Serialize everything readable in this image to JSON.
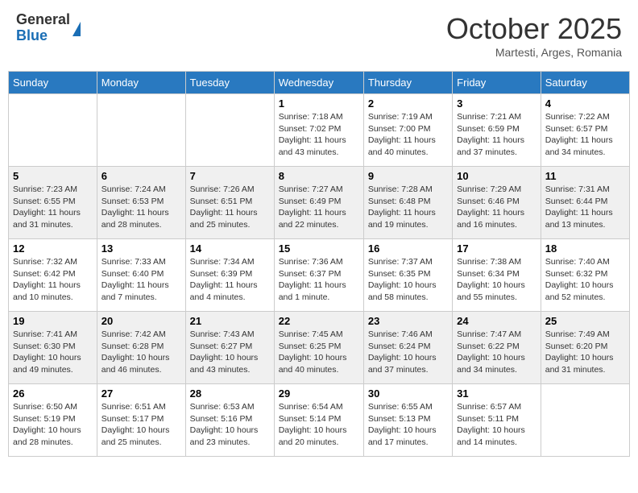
{
  "header": {
    "logo_general": "General",
    "logo_blue": "Blue",
    "month": "October 2025",
    "location": "Martesti, Arges, Romania"
  },
  "weekdays": [
    "Sunday",
    "Monday",
    "Tuesday",
    "Wednesday",
    "Thursday",
    "Friday",
    "Saturday"
  ],
  "weeks": [
    [
      {
        "day": "",
        "info": ""
      },
      {
        "day": "",
        "info": ""
      },
      {
        "day": "",
        "info": ""
      },
      {
        "day": "1",
        "info": "Sunrise: 7:18 AM\nSunset: 7:02 PM\nDaylight: 11 hours and 43 minutes."
      },
      {
        "day": "2",
        "info": "Sunrise: 7:19 AM\nSunset: 7:00 PM\nDaylight: 11 hours and 40 minutes."
      },
      {
        "day": "3",
        "info": "Sunrise: 7:21 AM\nSunset: 6:59 PM\nDaylight: 11 hours and 37 minutes."
      },
      {
        "day": "4",
        "info": "Sunrise: 7:22 AM\nSunset: 6:57 PM\nDaylight: 11 hours and 34 minutes."
      }
    ],
    [
      {
        "day": "5",
        "info": "Sunrise: 7:23 AM\nSunset: 6:55 PM\nDaylight: 11 hours and 31 minutes."
      },
      {
        "day": "6",
        "info": "Sunrise: 7:24 AM\nSunset: 6:53 PM\nDaylight: 11 hours and 28 minutes."
      },
      {
        "day": "7",
        "info": "Sunrise: 7:26 AM\nSunset: 6:51 PM\nDaylight: 11 hours and 25 minutes."
      },
      {
        "day": "8",
        "info": "Sunrise: 7:27 AM\nSunset: 6:49 PM\nDaylight: 11 hours and 22 minutes."
      },
      {
        "day": "9",
        "info": "Sunrise: 7:28 AM\nSunset: 6:48 PM\nDaylight: 11 hours and 19 minutes."
      },
      {
        "day": "10",
        "info": "Sunrise: 7:29 AM\nSunset: 6:46 PM\nDaylight: 11 hours and 16 minutes."
      },
      {
        "day": "11",
        "info": "Sunrise: 7:31 AM\nSunset: 6:44 PM\nDaylight: 11 hours and 13 minutes."
      }
    ],
    [
      {
        "day": "12",
        "info": "Sunrise: 7:32 AM\nSunset: 6:42 PM\nDaylight: 11 hours and 10 minutes."
      },
      {
        "day": "13",
        "info": "Sunrise: 7:33 AM\nSunset: 6:40 PM\nDaylight: 11 hours and 7 minutes."
      },
      {
        "day": "14",
        "info": "Sunrise: 7:34 AM\nSunset: 6:39 PM\nDaylight: 11 hours and 4 minutes."
      },
      {
        "day": "15",
        "info": "Sunrise: 7:36 AM\nSunset: 6:37 PM\nDaylight: 11 hours and 1 minute."
      },
      {
        "day": "16",
        "info": "Sunrise: 7:37 AM\nSunset: 6:35 PM\nDaylight: 10 hours and 58 minutes."
      },
      {
        "day": "17",
        "info": "Sunrise: 7:38 AM\nSunset: 6:34 PM\nDaylight: 10 hours and 55 minutes."
      },
      {
        "day": "18",
        "info": "Sunrise: 7:40 AM\nSunset: 6:32 PM\nDaylight: 10 hours and 52 minutes."
      }
    ],
    [
      {
        "day": "19",
        "info": "Sunrise: 7:41 AM\nSunset: 6:30 PM\nDaylight: 10 hours and 49 minutes."
      },
      {
        "day": "20",
        "info": "Sunrise: 7:42 AM\nSunset: 6:28 PM\nDaylight: 10 hours and 46 minutes."
      },
      {
        "day": "21",
        "info": "Sunrise: 7:43 AM\nSunset: 6:27 PM\nDaylight: 10 hours and 43 minutes."
      },
      {
        "day": "22",
        "info": "Sunrise: 7:45 AM\nSunset: 6:25 PM\nDaylight: 10 hours and 40 minutes."
      },
      {
        "day": "23",
        "info": "Sunrise: 7:46 AM\nSunset: 6:24 PM\nDaylight: 10 hours and 37 minutes."
      },
      {
        "day": "24",
        "info": "Sunrise: 7:47 AM\nSunset: 6:22 PM\nDaylight: 10 hours and 34 minutes."
      },
      {
        "day": "25",
        "info": "Sunrise: 7:49 AM\nSunset: 6:20 PM\nDaylight: 10 hours and 31 minutes."
      }
    ],
    [
      {
        "day": "26",
        "info": "Sunrise: 6:50 AM\nSunset: 5:19 PM\nDaylight: 10 hours and 28 minutes."
      },
      {
        "day": "27",
        "info": "Sunrise: 6:51 AM\nSunset: 5:17 PM\nDaylight: 10 hours and 25 minutes."
      },
      {
        "day": "28",
        "info": "Sunrise: 6:53 AM\nSunset: 5:16 PM\nDaylight: 10 hours and 23 minutes."
      },
      {
        "day": "29",
        "info": "Sunrise: 6:54 AM\nSunset: 5:14 PM\nDaylight: 10 hours and 20 minutes."
      },
      {
        "day": "30",
        "info": "Sunrise: 6:55 AM\nSunset: 5:13 PM\nDaylight: 10 hours and 17 minutes."
      },
      {
        "day": "31",
        "info": "Sunrise: 6:57 AM\nSunset: 5:11 PM\nDaylight: 10 hours and 14 minutes."
      },
      {
        "day": "",
        "info": ""
      }
    ]
  ]
}
